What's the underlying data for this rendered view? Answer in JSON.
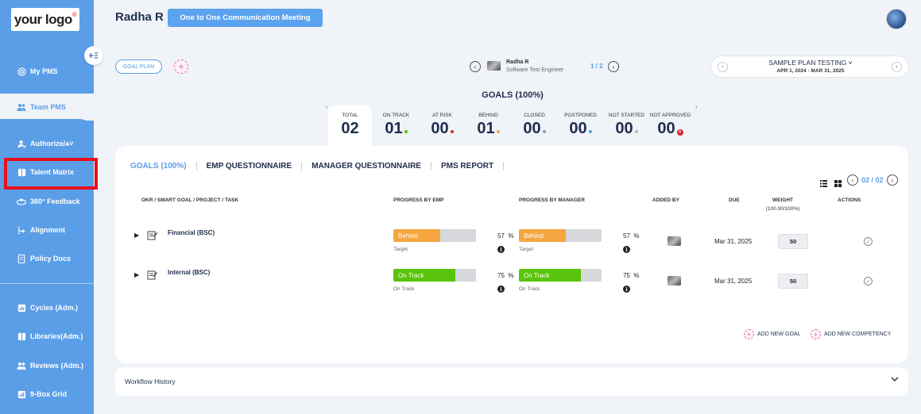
{
  "brand": {
    "logo_text": "your logo",
    "logo_mark": "®"
  },
  "colors": {
    "accent": "#5b9ee8",
    "sidebar": "#5b9ee8",
    "behind": "#f5a640",
    "on_track": "#59c40b",
    "at_risk": "#e0252a",
    "highlight": "#e8111b"
  },
  "sidebar": {
    "collapse_icon": "collapse-arrow-icon",
    "items": [
      {
        "label": "My PMS",
        "icon": "target-icon"
      },
      {
        "label": "Team PMS",
        "icon": "team-icon"
      },
      {
        "label": "Authorize/ᴀ˅",
        "icon": "user-check-icon"
      },
      {
        "label": "Talent Matrix",
        "icon": "matrix-icon"
      },
      {
        "label": "360° Feedback",
        "icon": "feedback-icon"
      },
      {
        "label": "Alignment",
        "icon": "alignment-icon"
      },
      {
        "label": "Policy Docs",
        "icon": "document-icon"
      },
      {
        "label": "Cycles (Adm.)",
        "icon": "chart-icon"
      },
      {
        "label": "Libraries(Adm.)",
        "icon": "library-icon"
      },
      {
        "label": "Reviews (Adm.)",
        "icon": "reviews-icon"
      },
      {
        "label": "9-Box Grid",
        "icon": "grid-chart-icon"
      }
    ]
  },
  "header": {
    "user_name": "Radha R",
    "meeting_button": "One to One Communication Meeting"
  },
  "toolbar": {
    "goal_plan": "GOAL PLAN",
    "add": "+"
  },
  "employee": {
    "name": "Radha R",
    "role": "Software Test Engineer",
    "page": "1 / 2"
  },
  "plan": {
    "title": "SAMPLE PLAN TESTING ˅",
    "dates": "APR 1, 2024 - MAR 31, 2025"
  },
  "goals_heading": "GOALS (100%)",
  "stats": [
    {
      "label": "TOTAL",
      "value": "02",
      "dot": ""
    },
    {
      "label": "ON TRACK",
      "value": "01",
      "dot": "#59c40b"
    },
    {
      "label": "AT RISK",
      "value": "00",
      "dot": "#e0252a"
    },
    {
      "label": "BEHIND",
      "value": "01",
      "dot": "#f5a640"
    },
    {
      "label": "CLOSED",
      "value": "00",
      "dot": "#999999"
    },
    {
      "label": "POSTPONED",
      "value": "00",
      "dot": "#5b9ee8"
    },
    {
      "label": "NOT STARTED",
      "value": "00",
      "dot": "#bbbbbb"
    },
    {
      "label": "NOT APPROVED",
      "value": "00",
      "dot": "#e0252a"
    }
  ],
  "tabs": [
    "GOALS (100%)",
    "EMP QUESTIONNAIRE",
    "MANAGER QUESTIONNAIRE",
    "PMS REPORT"
  ],
  "pagination": {
    "text": "02 / 02"
  },
  "table": {
    "headers": {
      "okr": "OKR / SMART GOAL / PROJECT / TASK",
      "emp": "PROGRESS BY EMP",
      "mgr": "PROGRESS BY MANAGER",
      "added_by": "ADDED BY",
      "due": "DUE",
      "weight": "WEIGHT",
      "weight_sub": "(100.00/100%)",
      "actions": "ACTIONS"
    },
    "rows": [
      {
        "name": "Financial (BSC)",
        "emp_status": "Behind",
        "emp_progress": 0.57,
        "emp_pct": "57",
        "emp_sub": "Target",
        "mgr_status": "Behind",
        "mgr_progress": 0.57,
        "mgr_pct": "57",
        "mgr_sub": "Target",
        "due": "Mar 31, 2025",
        "weight": "50"
      },
      {
        "name": "Internal (BSC)",
        "emp_status": "On Track",
        "emp_progress": 0.75,
        "emp_pct": "75",
        "emp_sub": "On Track",
        "mgr_status": "On Track",
        "mgr_progress": 0.75,
        "mgr_pct": "75",
        "mgr_sub": "On Track",
        "due": "Mar 31, 2025",
        "weight": "50"
      }
    ],
    "pct_sign": "%"
  },
  "actions": {
    "add_goal": "ADD NEW GOAL",
    "add_competency": "ADD NEW COMPETENCY"
  },
  "workflow": {
    "title": "Workflow History"
  }
}
